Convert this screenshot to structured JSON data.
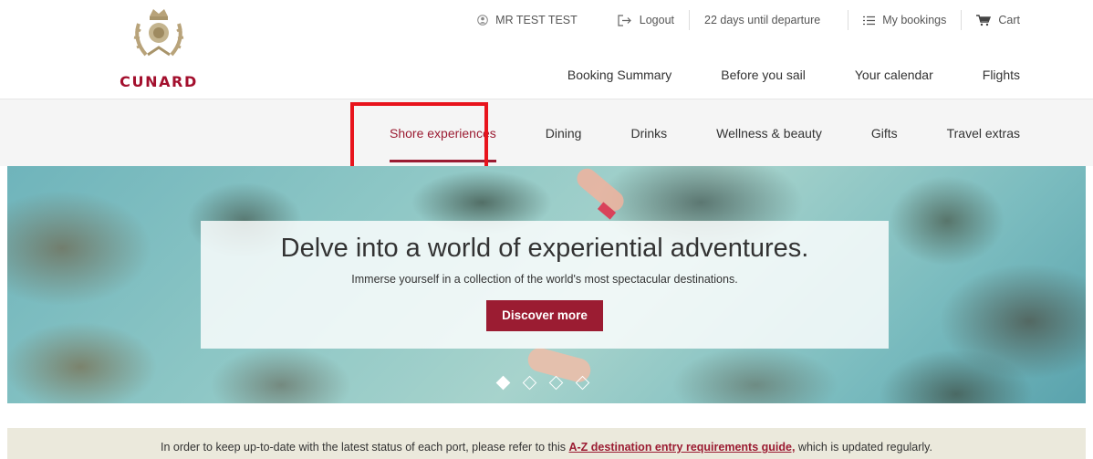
{
  "brand": {
    "name": "CUNARD",
    "color": "#a30f2d"
  },
  "utility": {
    "user": "MR TEST TEST",
    "logout": "Logout",
    "countdown": "22 days until departure",
    "my_bookings": "My bookings",
    "cart": "Cart"
  },
  "main_nav": [
    "Booking Summary",
    "Before you sail",
    "Your calendar",
    "Flights"
  ],
  "sub_nav": {
    "items": [
      "Shore experiences",
      "Dining",
      "Drinks",
      "Wellness & beauty",
      "Gifts",
      "Travel extras"
    ],
    "active": "Shore experiences",
    "accent": "#9b1c32"
  },
  "hero": {
    "title": "Delve into a world of experiential adventures.",
    "subtitle": "Immerse yourself in a collection of the world's most spectacular destinations.",
    "button": "Discover more",
    "slides_total": 4,
    "slide_active": 1
  },
  "notice": {
    "before": "In order to keep up-to-date with the latest status of each port, please refer to this ",
    "link": "A-Z destination entry requirements guide,",
    "after": " which is updated regularly."
  }
}
